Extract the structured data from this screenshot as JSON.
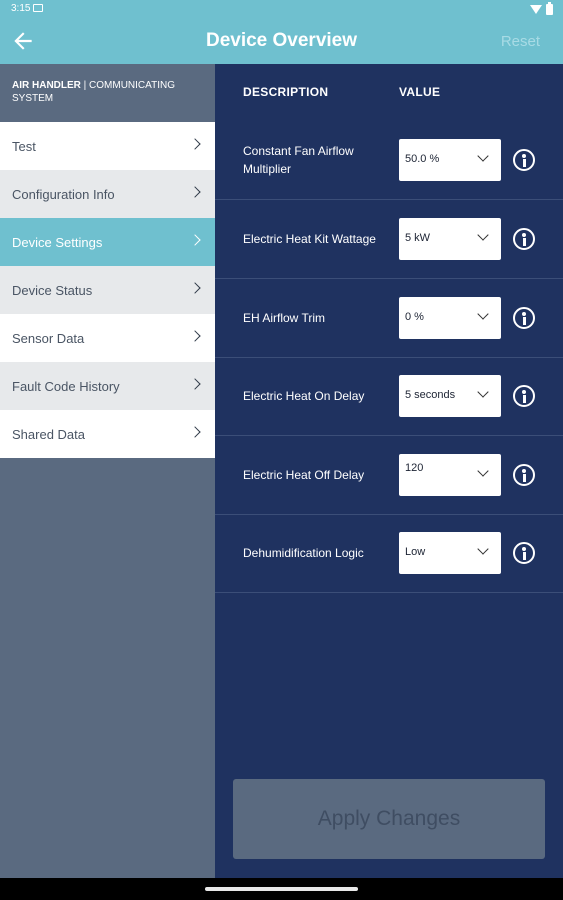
{
  "status": {
    "time": "3:15"
  },
  "app_bar": {
    "title": "Device Overview",
    "reset_label": "Reset"
  },
  "sidebar": {
    "header_strong": "AIR HANDLER",
    "header_rest": "| COMMUNICATING SYSTEM",
    "items": [
      {
        "label": "Test"
      },
      {
        "label": "Configuration Info"
      },
      {
        "label": "Device Settings"
      },
      {
        "label": "Device Status"
      },
      {
        "label": "Sensor Data"
      },
      {
        "label": "Fault Code History"
      },
      {
        "label": "Shared Data"
      }
    ]
  },
  "main": {
    "col_description": "DESCRIPTION",
    "col_value": "VALUE",
    "settings": [
      {
        "label": "Constant Fan Airflow Multiplier",
        "value": "50.0 %"
      },
      {
        "label": "Electric Heat Kit Wattage",
        "value": "5 kW"
      },
      {
        "label": "EH Airflow Trim",
        "value": "0 %"
      },
      {
        "label": "Electric Heat On Delay",
        "value": "5 seconds"
      },
      {
        "label": "Electric Heat Off Delay",
        "value": "120"
      },
      {
        "label": "Dehumidification Logic",
        "value": "Low"
      }
    ],
    "apply_label": "Apply Changes"
  },
  "colors": {
    "accent": "#6fc0cf",
    "panel": "#1f3260",
    "sidebar": "#5a6a80"
  }
}
